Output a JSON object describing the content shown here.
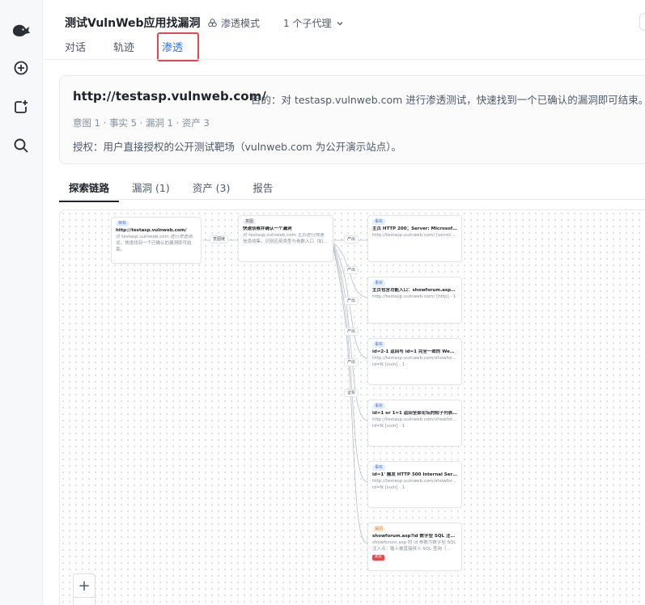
{
  "header": {
    "title": "测试VulnWeb应用找漏洞",
    "mode_label": "渗透模式",
    "agents_label": "1 个子代理"
  },
  "top_tabs": [
    {
      "label": "对话",
      "active": false
    },
    {
      "label": "轨迹",
      "active": false
    },
    {
      "label": "渗透",
      "active": true
    }
  ],
  "target": {
    "url": "http://testasp.vulnweb.com/",
    "goal": "目的：对 testasp.vulnweb.com 进行渗透测试，快速找到一个已确认的漏洞即可结束。",
    "stats": "意图 1 · 事实 5 · 漏洞 1 · 资产 3",
    "auth": "授权：用户直接授权的公开测试靶场（vulnweb.com 为公开演示站点）。"
  },
  "sub_tabs": [
    {
      "label": "探索链路",
      "active": true
    },
    {
      "label": "漏洞 (1)",
      "active": false
    },
    {
      "label": "资产 (3)",
      "active": false
    },
    {
      "label": "报告",
      "active": false
    }
  ],
  "graph": {
    "target_node": {
      "tag": "目标",
      "title": "http://testasp.vulnweb.com/",
      "desc": "对 testasp.vulnweb.com 进行渗透测试，快速找到一个已确认的漏洞即可结束。"
    },
    "intent_node": {
      "tag": "意图",
      "title": "快速侦察并确认一个漏洞",
      "desc": "对 testasp.vulnweb.com 主页进行快速信息收集，识别应用类型与参数入口（如..."
    },
    "edge_to_intent": "意图链",
    "facts": [
      {
        "tag": "事实",
        "title": "主页 HTTP 200；Server: Microsoft-IIS...",
        "desc": "http://testasp.vulnweb.com/ [service] · 1",
        "edge": "产出"
      },
      {
        "tag": "事实",
        "title": "主页包含功能入口：showforum.asp?i...",
        "desc": "http://testasp.vulnweb.com/ [http] · 1",
        "edge": "产出"
      },
      {
        "tag": "事实",
        "title": "id=2-1 返回与 id=1 完全一致的 Weath...",
        "desc": "http://testasp.vulnweb.com/showforum.a",
        "desc2": "id=N [vuln] · 1",
        "edge": "产出"
      },
      {
        "tag": "事实",
        "title": "id=1 or 1=1 返回全部论坛的帖子列表...",
        "desc": "http://testasp.vulnweb.com/showforum.a",
        "desc2": "id=N [vuln] · 1",
        "edge": "产出"
      },
      {
        "tag": "事实",
        "title": "id=1' 触发 HTTP 500 Internal Server E...",
        "desc": "http://testasp.vulnweb.com/showforum.a",
        "desc2": "id=N [vuln] · 1",
        "edge": "产出"
      }
    ],
    "vuln": {
      "tag": "漏洞",
      "title": "showforum.asp?id 数字型 SQL 注入（...",
      "desc": "showforum.asp 的 id 参数为数字型 SQL 注入点：输入被直接拼入 SQL 查询（...",
      "severity": "高危",
      "edge": "证实"
    }
  },
  "zoom": {
    "in": "+",
    "out": "−"
  },
  "colors": {
    "accent": "#3370ff",
    "highlight": "#e5484d",
    "danger": "#e5484d"
  }
}
